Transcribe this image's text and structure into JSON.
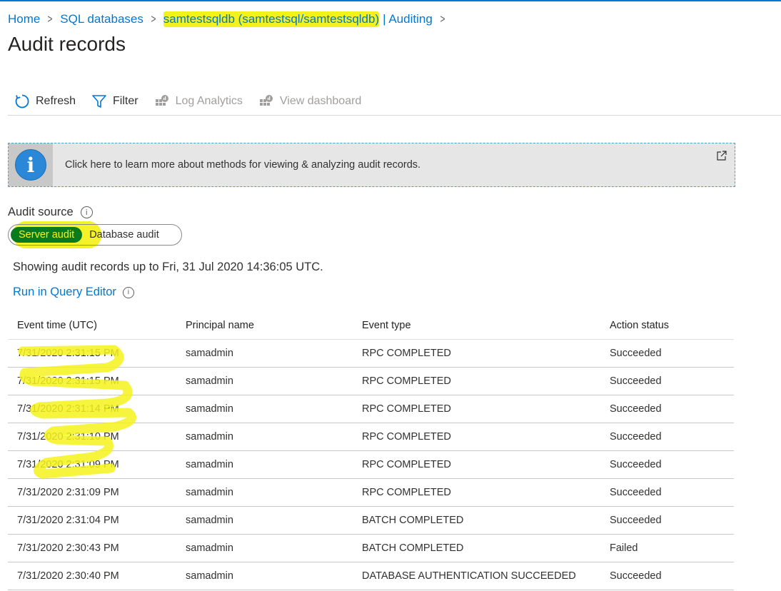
{
  "breadcrumb": {
    "items": [
      "Home",
      "SQL databases",
      "samtestsqldb (samtestsql/samtestsqldb)",
      "| Auditing"
    ],
    "separator": ">"
  },
  "page": {
    "title": "Audit records"
  },
  "toolbar": {
    "refresh": "Refresh",
    "filter": "Filter",
    "log_analytics": "Log Analytics",
    "view_dashboard": "View dashboard"
  },
  "banner": {
    "text": "Click here to learn more about methods for viewing & analyzing audit records.",
    "icon": "info-icon"
  },
  "audit_source": {
    "label": "Audit source",
    "options": [
      "Server audit",
      "Database audit"
    ],
    "selected": "Server audit"
  },
  "showing_text": "Showing audit records up to Fri, 31 Jul 2020 14:36:05 UTC.",
  "query_link": "Run in Query Editor",
  "table": {
    "headers": [
      "Event time (UTC)",
      "Principal name",
      "Event type",
      "Action status"
    ],
    "rows": [
      [
        "7/31/2020 2:31:15 PM",
        "samadmin",
        "RPC COMPLETED",
        "Succeeded"
      ],
      [
        "7/31/2020 2:31:15 PM",
        "samadmin",
        "RPC COMPLETED",
        "Succeeded"
      ],
      [
        "7/31/2020 2:31:14 PM",
        "samadmin",
        "RPC COMPLETED",
        "Succeeded"
      ],
      [
        "7/31/2020 2:31:10 PM",
        "samadmin",
        "RPC COMPLETED",
        "Succeeded"
      ],
      [
        "7/31/2020 2:31:09 PM",
        "samadmin",
        "RPC COMPLETED",
        "Succeeded"
      ],
      [
        "7/31/2020 2:31:09 PM",
        "samadmin",
        "RPC COMPLETED",
        "Succeeded"
      ],
      [
        "7/31/2020 2:31:04 PM",
        "samadmin",
        "BATCH COMPLETED",
        "Succeeded"
      ],
      [
        "7/31/2020 2:30:43 PM",
        "samadmin",
        "BATCH COMPLETED",
        "Failed"
      ],
      [
        "7/31/2020 2:30:40 PM",
        "samadmin",
        "DATABASE AUTHENTICATION SUCCEEDED",
        "Succeeded"
      ]
    ]
  },
  "colors": {
    "accent": "#0078d4",
    "highlight": "#f4f21b",
    "selected_toggle": "#0a7a1e"
  }
}
